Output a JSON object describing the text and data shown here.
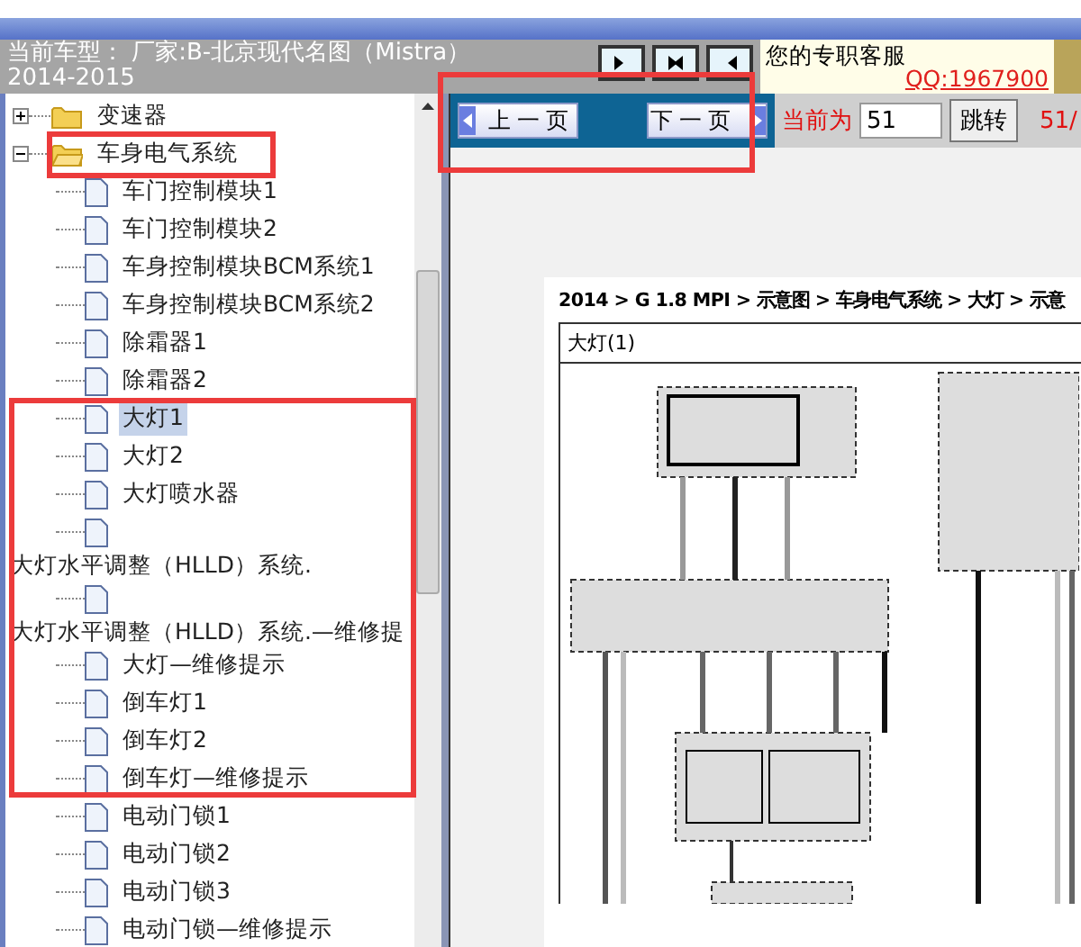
{
  "header": {
    "vehicle": "当前车型： 厂家:B-北京现代名图（Mistra）2014-2015"
  },
  "support": {
    "label": "您的专职客服",
    "qq": "QQ:1967900"
  },
  "pager": {
    "prev": "上一页",
    "next": "下一页",
    "current_label": "当前为",
    "page_value": "51",
    "jump": "跳转",
    "count": "51/"
  },
  "tree": [
    {
      "label": "变速器",
      "expanded": false
    },
    {
      "label": "车身电气系统",
      "expanded": true,
      "children": [
        {
          "label": "车门控制模块1",
          "kind": "page",
          "selected": false
        },
        {
          "label": "车门控制模块2",
          "kind": "page",
          "selected": false
        },
        {
          "label": "车身控制模块BCM系统1",
          "kind": "page",
          "selected": false
        },
        {
          "label": "车身控制模块BCM系统2",
          "kind": "page",
          "selected": false
        },
        {
          "label": "除霜器1",
          "kind": "page",
          "selected": false
        },
        {
          "label": "除霜器2",
          "kind": "page",
          "selected": false
        },
        {
          "label": "大灯1",
          "kind": "page",
          "selected": true
        },
        {
          "label": "大灯2",
          "kind": "page",
          "selected": false
        },
        {
          "label": "大灯喷水器",
          "kind": "page",
          "selected": false
        },
        {
          "label": "大灯水平调整（HLLD）系统.",
          "kind": "wrapped",
          "selected": false
        },
        {
          "label": "大灯水平调整（HLLD）系统.—维修提",
          "kind": "wrapped",
          "selected": false
        },
        {
          "label": "大灯—维修提示",
          "kind": "page",
          "selected": false
        },
        {
          "label": "倒车灯1",
          "kind": "page",
          "selected": false
        },
        {
          "label": "倒车灯2",
          "kind": "page",
          "selected": false
        },
        {
          "label": "倒车灯—维修提示",
          "kind": "page",
          "selected": false
        },
        {
          "label": "电动门锁1",
          "kind": "page",
          "selected": false
        },
        {
          "label": "电动门锁2",
          "kind": "page",
          "selected": false
        },
        {
          "label": "电动门锁3",
          "kind": "page",
          "selected": false
        },
        {
          "label": "电动门锁—维修提示",
          "kind": "page",
          "selected": false
        }
      ]
    }
  ],
  "document": {
    "breadcrumb": "2014 > G 1.8 MPI > 示意图 > 车身电气系统 > 大灯 > 示意",
    "title": "大灯(1)"
  }
}
